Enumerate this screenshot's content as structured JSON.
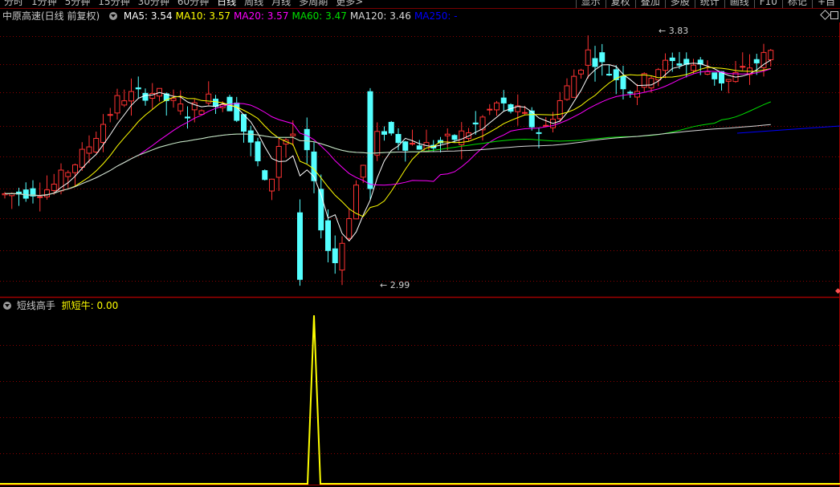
{
  "toolbar": {
    "periods": [
      "分时",
      "1分钟",
      "5分钟",
      "15分钟",
      "30分钟",
      "60分钟",
      "日线",
      "周线",
      "月线",
      "多周期",
      "更多>"
    ],
    "active_period": "日线",
    "right_buttons": [
      "显示",
      "复权",
      "叠加",
      "多股",
      "统计",
      "画线",
      "F10",
      "标记",
      "+自"
    ]
  },
  "stock": {
    "title": "中原高速(日线 前复权)"
  },
  "ma": [
    {
      "label": "MA5: 3.54",
      "color": "#ffffff"
    },
    {
      "label": "MA10: 3.57",
      "color": "#ffff00"
    },
    {
      "label": "MA20: 3.57",
      "color": "#ff00ff"
    },
    {
      "label": "MA60: 3.47",
      "color": "#00e000"
    },
    {
      "label": "MA120: 3.46",
      "color": "#d8d8d8"
    },
    {
      "label": "MA250: -",
      "color": "#0000ff"
    }
  ],
  "annotations": {
    "high": "3.83",
    "low": "2.99"
  },
  "indicator": {
    "name": "短线高手",
    "value_label": "抓短牛: 0.00",
    "value_color": "#ffff00"
  },
  "colors": {
    "up": "#ff3232",
    "down": "#54ffff",
    "grid": "#8b0000",
    "border": "#a00000"
  },
  "chart_data": {
    "type": "candlestick",
    "count": 110,
    "price_range_shown": [
      2.99,
      3.83
    ],
    "signal_series": {
      "name": "抓短牛",
      "baseline": 0,
      "peak_at_candle_index": 40
    }
  }
}
